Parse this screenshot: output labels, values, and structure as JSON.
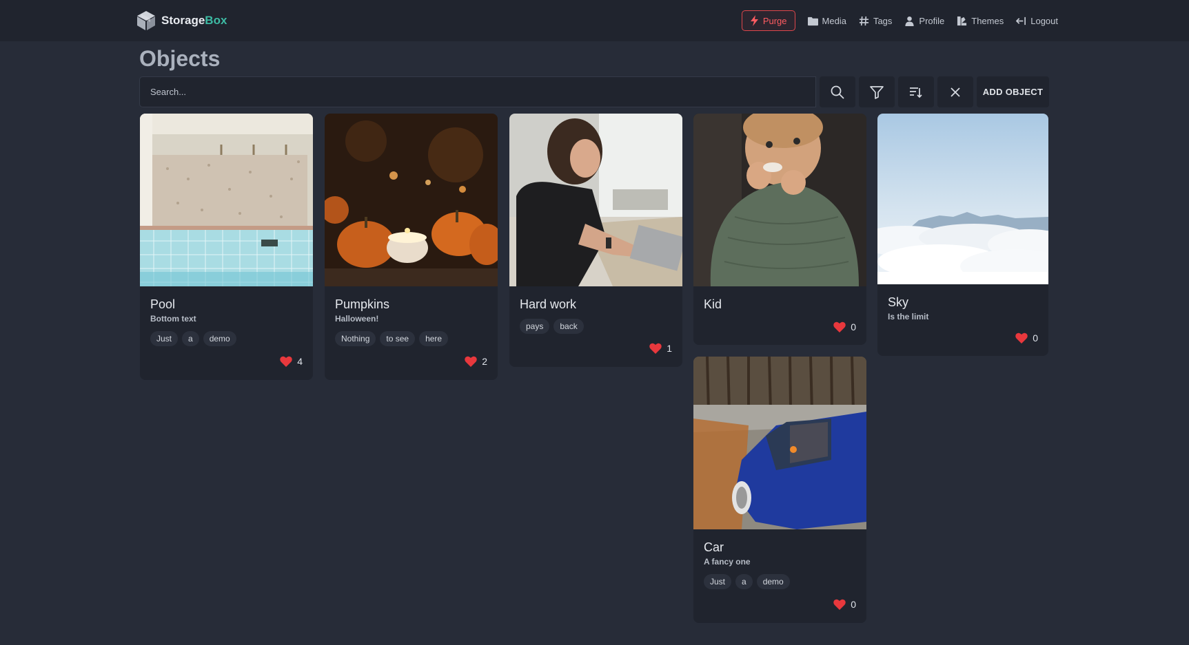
{
  "brand": {
    "name_main": "Storage",
    "name_accent": "Box"
  },
  "nav": {
    "purge": "Purge",
    "media": "Media",
    "tags": "Tags",
    "profile": "Profile",
    "themes": "Themes",
    "logout": "Logout"
  },
  "page": {
    "title": "Objects"
  },
  "search": {
    "placeholder": "Search...",
    "value": ""
  },
  "toolbar": {
    "add_label": "ADD OBJECT"
  },
  "colors": {
    "accent": "#3dbba4",
    "danger": "#e0474c",
    "heart": "#e8383d",
    "background": "#272c38",
    "surface": "#20242e"
  },
  "objects": [
    {
      "title": "Pool",
      "subtitle": "Bottom text",
      "tags": [
        "Just",
        "a",
        "demo"
      ],
      "likes": "4"
    },
    {
      "title": "Pumpkins",
      "subtitle": "Halloween!",
      "tags": [
        "Nothing",
        "to see",
        "here"
      ],
      "likes": "2"
    },
    {
      "title": "Hard work",
      "subtitle": "",
      "tags": [
        "pays",
        "back"
      ],
      "likes": "1"
    },
    {
      "title": "Kid",
      "subtitle": "",
      "tags": [],
      "likes": "0"
    },
    {
      "title": "Sky",
      "subtitle": "Is the limit",
      "tags": [],
      "likes": "0"
    },
    {
      "title": "Car",
      "subtitle": "A fancy one",
      "tags": [
        "Just",
        "a",
        "demo"
      ],
      "likes": "0"
    }
  ]
}
